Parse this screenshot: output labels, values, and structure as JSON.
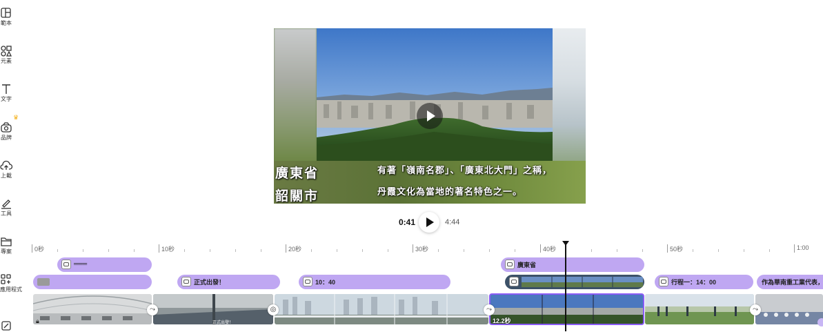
{
  "sidebar": {
    "items": [
      {
        "label": "範本",
        "icon": "template-icon"
      },
      {
        "label": "元素",
        "icon": "elements-icon"
      },
      {
        "label": "文字",
        "icon": "text-icon"
      },
      {
        "label": "品牌",
        "icon": "brand-icon"
      },
      {
        "label": "上載",
        "icon": "upload-icon"
      },
      {
        "label": "工具",
        "icon": "draw-icon"
      },
      {
        "label": "專案",
        "icon": "folder-icon"
      },
      {
        "label": "應用程式",
        "icon": "apps-icon"
      }
    ],
    "crown": "♛"
  },
  "preview": {
    "caption_left_1": "廣東省",
    "caption_left_2": "韶關市",
    "caption_right_1": "有著「嶺南名郡」、「廣東北大門」之稱，",
    "caption_right_2": "丹霞文化為當地的著名特色之一。"
  },
  "transport": {
    "current_time": "0:41",
    "total_time": "4:44"
  },
  "ruler": {
    "labels": [
      "0秒",
      "10秒",
      "20秒",
      "30秒",
      "40秒",
      "50秒",
      "1:00"
    ]
  },
  "tracks": {
    "row1": [
      {
        "text": "═══"
      },
      {
        "text": "廣東省"
      }
    ],
    "row2": [
      {
        "text": ""
      },
      {
        "text": "正式出發！"
      },
      {
        "text": "10：40"
      },
      {
        "text": ""
      },
      {
        "text": "行程一：14：00"
      },
      {
        "text": "作為華南重工業代表，"
      }
    ],
    "selected_clip_duration": "12.2秒",
    "clip_overlay_text": "正式出發！"
  },
  "colors": {
    "pill": "#bfa7f2",
    "accent": "#8b5cf6"
  }
}
